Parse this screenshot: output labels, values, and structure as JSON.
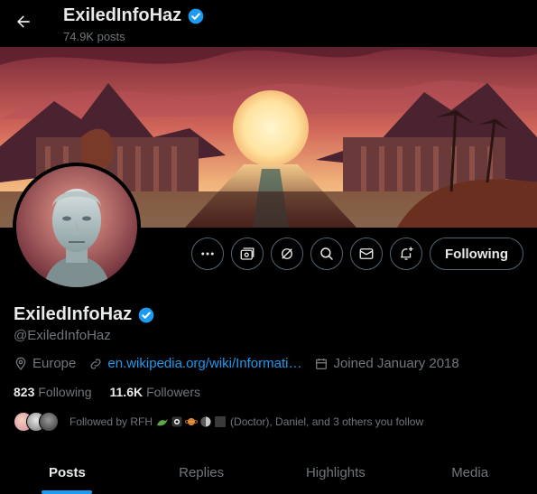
{
  "header": {
    "name": "ExiledInfoHaz",
    "posts_count": "74.9K posts"
  },
  "profile": {
    "name": "ExiledInfoHaz",
    "handle": "@ExiledInfoHaz",
    "location": "Europe",
    "website": "en.wikipedia.org/wiki/Informati…",
    "joined": "Joined January 2018",
    "following_count": "823",
    "following_label": "Following",
    "followers_count": "11.6K",
    "followers_label": "Followers",
    "followed_by_prefix": "Followed by RFH",
    "followed_by_suffix": "(Doctor), Daniel, and 3 others you follow"
  },
  "actions": {
    "follow_label": "Following"
  },
  "tabs": [
    {
      "label": "Posts",
      "active": true
    },
    {
      "label": "Replies",
      "active": false
    },
    {
      "label": "Highlights",
      "active": false
    },
    {
      "label": "Media",
      "active": false
    }
  ],
  "colors": {
    "accent": "#1d9bf0",
    "verified": "#1d9bf0",
    "muted": "#71767b"
  }
}
